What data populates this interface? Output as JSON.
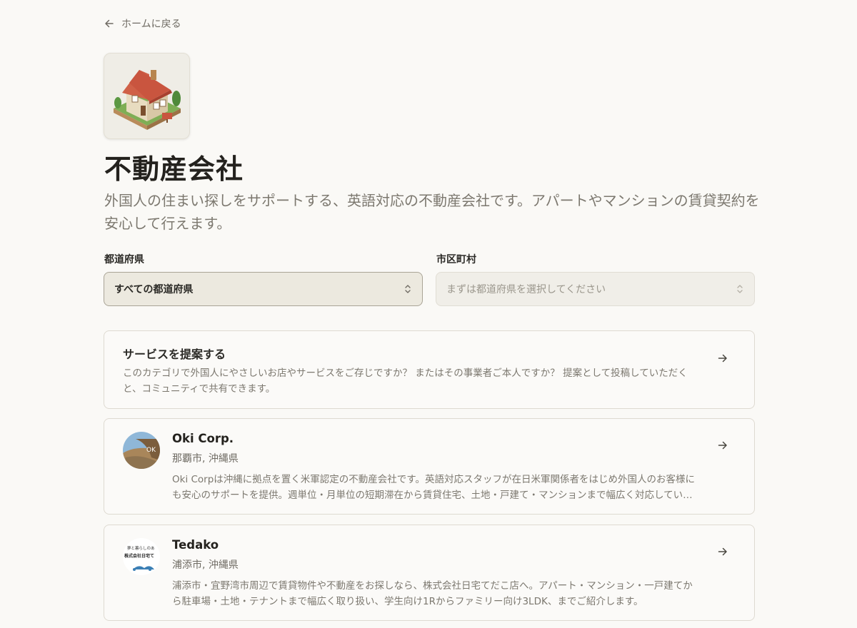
{
  "nav": {
    "back_label": "ホームに戻る"
  },
  "header": {
    "title": "不動産会社",
    "description": "外国人の住まい探しをサポートする、英語対応の不動産会社です。アパートやマンションの賃貸契約を安心して行えます。"
  },
  "filters": {
    "prefecture": {
      "label": "都道府県",
      "value": "すべての都道府県"
    },
    "city": {
      "label": "市区町村",
      "placeholder": "まずは都道府県を選択してください"
    }
  },
  "suggest": {
    "title": "サービスを提案する",
    "text": "このカテゴリで外国人にやさしいお店やサービスをご存じですか？ またはその事業者ご本人ですか？ 提案として投稿していただくと、コミュニティで共有できます。"
  },
  "listings": [
    {
      "name": "Oki Corp.",
      "location": "那覇市, 沖縄県",
      "description": "Oki Corpは沖縄に拠点を置く米軍認定の不動産会社です。英語対応スタッフが在日米軍関係者をはじめ外国人のお客様にも安心のサポートを提供。週単位・月単位の短期滞在から賃貸住宅、土地・戸建て・マンションまで幅広く対応しています。",
      "avatar_text": "OK"
    },
    {
      "name": "Tedako",
      "location": "浦添市, 沖縄県",
      "description": "浦添市・宜野湾市周辺で賃貸物件や不動産をお探しなら、株式会社日宅てだこ店へ。アパート・マンション・一戸建てから駐車場・土地・テナントまで幅広く取り扱い、学生向け1Rからファミリー向け3LDK、までご紹介します。",
      "avatar_line1": "夢と暮らしのあ",
      "avatar_line2": "株式会社日宅て"
    }
  ],
  "colors": {
    "background": "#faf9f6",
    "accent_roof": "#c9553f",
    "text_muted": "#7c786f"
  }
}
